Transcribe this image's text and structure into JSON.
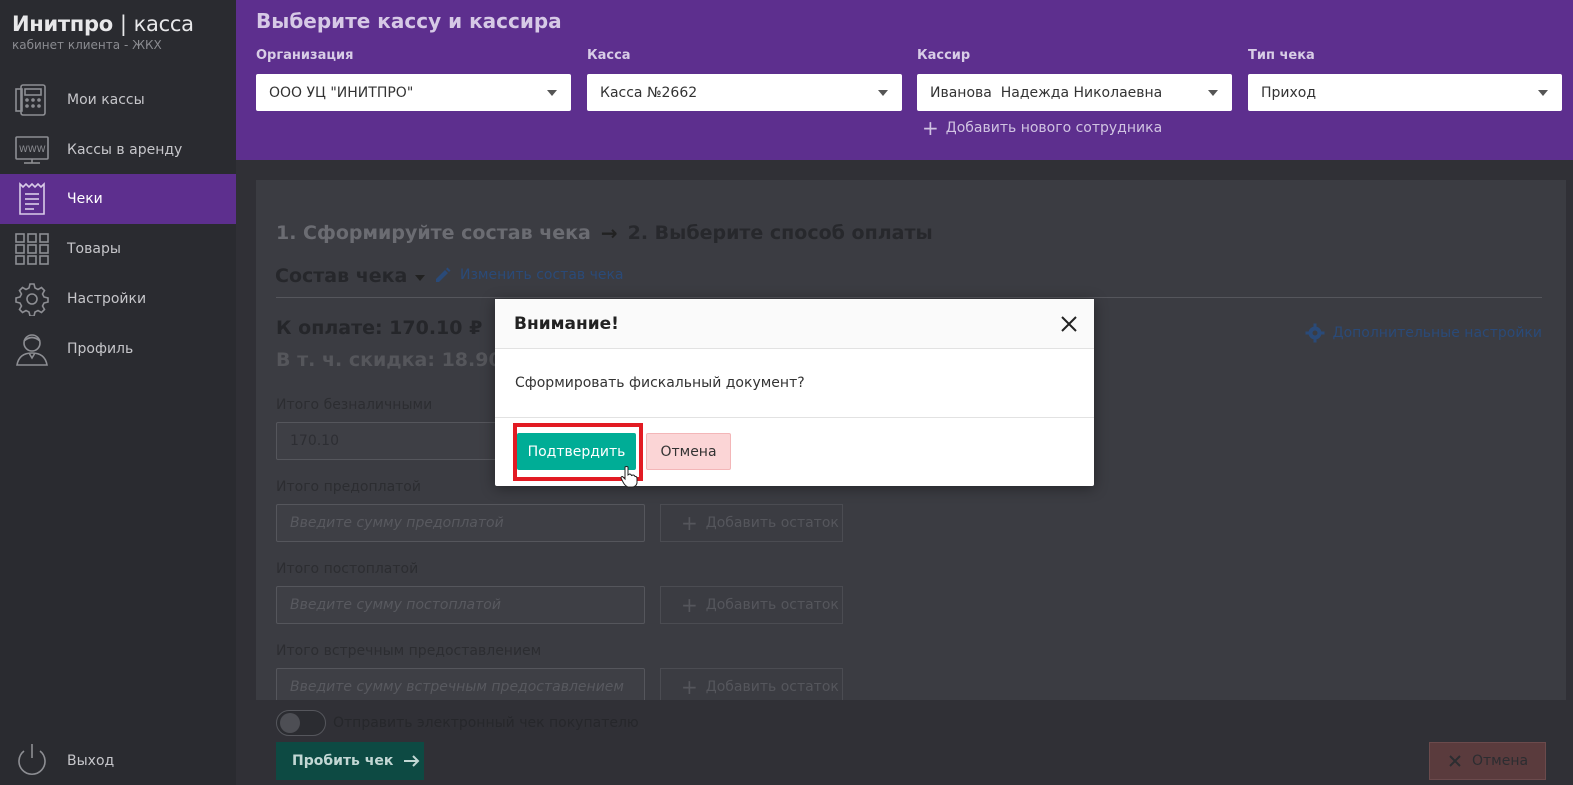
{
  "brand": {
    "name": "Инитпро",
    "separator": "|",
    "product": "касса",
    "subtitle": "кабинет клиента - ЖКХ"
  },
  "sidebar": {
    "items": [
      {
        "label": "Мои кассы",
        "icon": "cash-register-icon"
      },
      {
        "label": "Кассы в аренду",
        "icon": "www-icon"
      },
      {
        "label": "Чеки",
        "icon": "receipt-icon",
        "active": true
      },
      {
        "label": "Товары",
        "icon": "grid-icon"
      },
      {
        "label": "Настройки",
        "icon": "gear-icon"
      },
      {
        "label": "Профиль",
        "icon": "user-icon"
      }
    ],
    "logout": "Выход"
  },
  "header": {
    "title": "Выберите кассу и кассира",
    "fields": [
      {
        "caption": "Организация",
        "value": "ООО УЦ \"ИНИТПРО\""
      },
      {
        "caption": "Касса",
        "value": "Касса №2662"
      },
      {
        "caption": "Кассир",
        "value": "Иванова  Надежда Николаевна"
      },
      {
        "caption": "Тип чека",
        "value": "Приход"
      }
    ],
    "add_employee": "Добавить нового сотрудника"
  },
  "main": {
    "step1": "1. Сформируйте состав чека",
    "arrow": "→",
    "step2": "2. Выберите способ оплаты",
    "composition": "Состав чека",
    "edit_composition": "Изменить состав чека",
    "to_pay": "К оплате: 170.10 ₽",
    "discount": "В т. ч. скидка: 18.90 ₽",
    "advanced": "Дополнительные настройки",
    "cashless_label": "Итого безналичными",
    "cashless_value": "170.10",
    "prepay_label": "Итого предоплатой",
    "prepay_placeholder": "Введите сумму предоплатой",
    "postpay_label": "Итого постоплатой",
    "postpay_placeholder": "Введите сумму постоплатой",
    "counter_label": "Итого встречным предоставлением",
    "counter_placeholder": "Введите сумму встречным предоставлением",
    "add_rest": "Добавить остаток",
    "send_receipt": "Отправить электронный чек покупателю",
    "print_button": "Пробить чек",
    "cancel_button": "Отмена"
  },
  "modal": {
    "title": "Внимание!",
    "message": "Сформировать фискальный документ?",
    "confirm": "Подтвердить",
    "cancel": "Отмена"
  },
  "colors": {
    "accent": "#5d2f8e",
    "confirm": "#00ad96",
    "cancel_bg": "#fbd5d6",
    "highlight": "#e21b23"
  }
}
